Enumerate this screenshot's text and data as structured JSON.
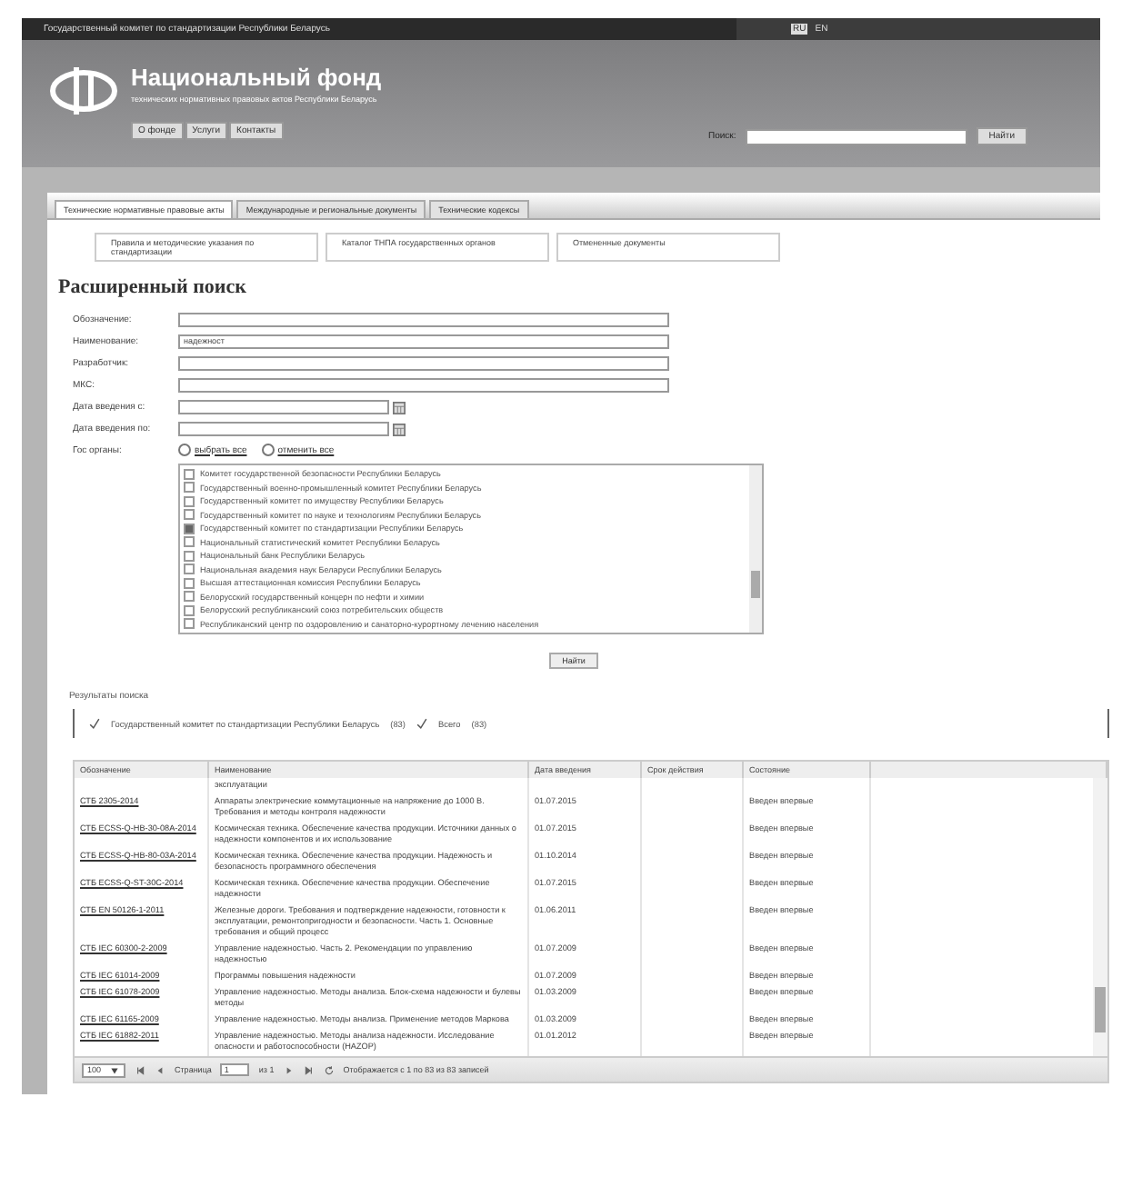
{
  "top_bar": {
    "text": "Государственный комитет по стандартизации Республики Беларусь",
    "languages": [
      {
        "label": "RU",
        "selected": true
      },
      {
        "label": "EN",
        "selected": false
      }
    ]
  },
  "header": {
    "title": "Национальный фонд",
    "subtitle": "технических нормативных правовых актов Республики Беларусь",
    "nav": [
      "О фонде",
      "Услуги",
      "Контакты"
    ],
    "search_label": "Поиск:",
    "search_button": "Найти"
  },
  "tabs": [
    {
      "label": "Технические нормативные правовые акты",
      "selected": true
    },
    {
      "label": "Международные и региональные документы",
      "selected": false
    },
    {
      "label": "Технические кодексы",
      "selected": false
    }
  ],
  "subtabs": [
    "Правила и методические указания по стандартизации",
    "Каталог ТНПА государственных органов",
    "Отмененные документы"
  ],
  "heading": "Расширенный поиск",
  "form": {
    "fields": [
      {
        "label": "Обозначение:",
        "kind": "text"
      },
      {
        "label": "Наименование:",
        "kind": "text",
        "value": "надежност"
      },
      {
        "label": "Разработчик:",
        "kind": "text"
      },
      {
        "label": "МКС:",
        "kind": "text"
      },
      {
        "label": "Дата введения с:",
        "kind": "date"
      },
      {
        "label": "Дата введения по:",
        "kind": "date"
      }
    ],
    "agencies_label": "Гос органы:",
    "radios": [
      {
        "label": "выбрать все",
        "selected": false
      },
      {
        "label": "отменить все",
        "selected": false
      }
    ],
    "agencies": [
      {
        "label": "Комитет государственной безопасности Республики Беларусь",
        "checked": false
      },
      {
        "label": "Государственный военно-промышленный комитет Республики Беларусь",
        "checked": false
      },
      {
        "label": "Государственный комитет по имуществу Республики Беларусь",
        "checked": false
      },
      {
        "label": "Государственный комитет по науке и технологиям Республики Беларусь",
        "checked": false
      },
      {
        "label": "Государственный комитет по стандартизации Республики Беларусь",
        "checked": true
      },
      {
        "label": "Национальный статистический комитет Республики Беларусь",
        "checked": false
      },
      {
        "label": "Национальный банк Республики Беларусь",
        "checked": false
      },
      {
        "label": "Национальная академия наук Беларуси Республики Беларусь",
        "checked": false
      },
      {
        "label": "Высшая аттестационная комиссия Республики Беларусь",
        "checked": false
      },
      {
        "label": "Белорусский государственный концерн по нефти и химии",
        "checked": false
      },
      {
        "label": "Белорусский республиканский союз потребительских обществ",
        "checked": false
      },
      {
        "label": "Республиканский центр по оздоровлению и санаторно-курортному лечению населения",
        "checked": false
      }
    ],
    "submit": "Найти"
  },
  "results": {
    "title": "Результаты поиска",
    "filters": [
      {
        "label": "Государственный комитет по стандартизации Республики Беларусь",
        "count": "(83)"
      },
      {
        "label": "Всего",
        "count": "(83)"
      }
    ],
    "columns": [
      "Обозначение",
      "Наименование",
      "Дата введения",
      "Срок действия",
      "Состояние"
    ],
    "rows": [
      {
        "code": "",
        "name": "эксплуатации",
        "date": "",
        "status": ""
      },
      {
        "code": "СТБ 2305-2014",
        "name": "Аппараты электрические коммутационные на напряжение до 1000 В. Требования и методы контроля надежности",
        "date": "01.07.2015",
        "status": "Введен впервые"
      },
      {
        "code": "СТБ ECSS-Q-HB-30-08A-2014",
        "name": "Космическая техника. Обеспечение качества продукции. Источники данных о надежности компонентов и их использование",
        "date": "01.07.2015",
        "status": "Введен впервые"
      },
      {
        "code": "СТБ ECSS-Q-HB-80-03A-2014",
        "name": "Космическая техника. Обеспечение качества продукции. Надежность и безопасность программного обеспечения",
        "date": "01.10.2014",
        "status": "Введен впервые"
      },
      {
        "code": "СТБ ECSS-Q-ST-30C-2014",
        "name": "Космическая техника. Обеспечение качества продукции. Обеспечение надежности",
        "date": "01.07.2015",
        "status": "Введен впервые"
      },
      {
        "code": "СТБ EN 50126-1-2011",
        "name": "Железные дороги. Требования и подтверждение надежности, готовности к эксплуатации, ремонтопригодности и безопасности. Часть 1. Основные требования и общий процесс",
        "date": "01.06.2011",
        "status": "Введен впервые"
      },
      {
        "code": "СТБ IEC 60300-2-2009",
        "name": "Управление надежностью. Часть 2. Рекомендации по управлению надежностью",
        "date": "01.07.2009",
        "status": "Введен впервые"
      },
      {
        "code": "СТБ IEC 61014-2009",
        "name": "Программы повышения надежности",
        "date": "01.07.2009",
        "status": "Введен впервые"
      },
      {
        "code": "СТБ IEC 61078-2009",
        "name": "Управление надежностью. Методы анализа. Блок-схема надежности и булевы методы",
        "date": "01.03.2009",
        "status": "Введен впервые"
      },
      {
        "code": "СТБ IEC 61165-2009",
        "name": "Управление надежностью. Методы анализа. Применение методов Маркова",
        "date": "01.03.2009",
        "status": "Введен впервые"
      },
      {
        "code": "СТБ IEC 61882-2011",
        "name": "Управление надежностью. Методы анализа надежности. Исследование опасности и работоспособности (HAZOP)",
        "date": "01.01.2012",
        "status": "Введен впервые"
      }
    ],
    "pager": {
      "page_size": "100",
      "page_label": "Страница",
      "page": "1",
      "of": "из 1",
      "summary": "Отображается с 1 по 83 из 83 записей"
    }
  }
}
